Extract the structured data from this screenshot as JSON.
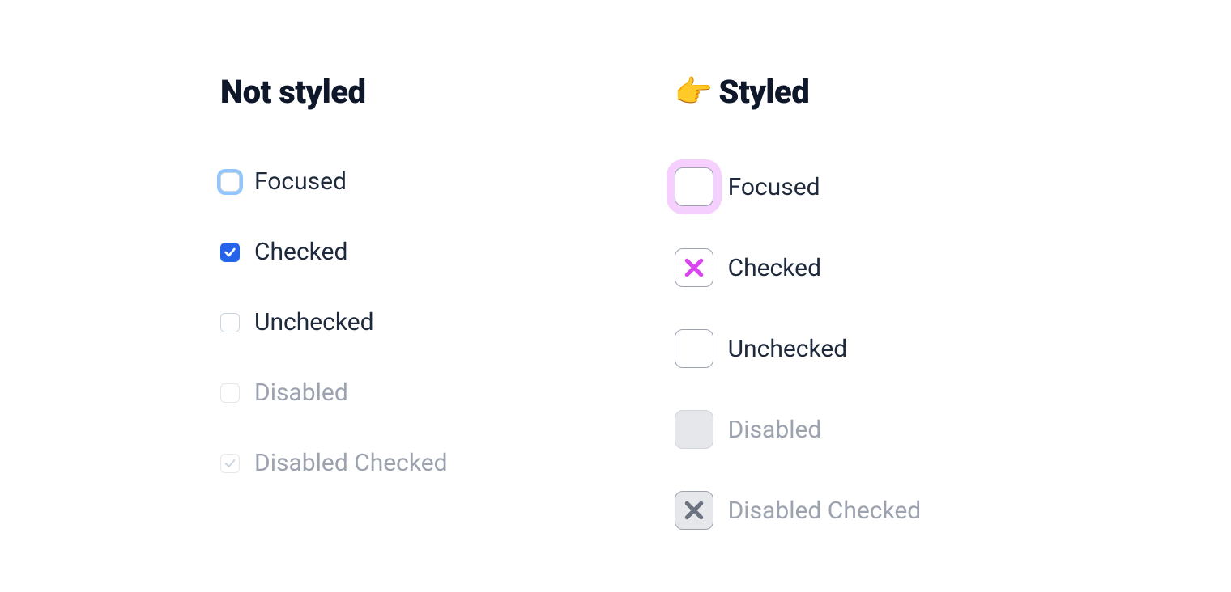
{
  "columns": {
    "not_styled": {
      "heading": "Not styled",
      "states": {
        "focused": "Focused",
        "checked": "Checked",
        "unchecked": "Unchecked",
        "disabled": "Disabled",
        "disabled_checked": "Disabled Checked"
      }
    },
    "styled": {
      "heading": "Styled",
      "emoji": "👉",
      "states": {
        "focused": "Focused",
        "checked": "Checked",
        "unchecked": "Unchecked",
        "disabled": "Disabled",
        "disabled_checked": "Disabled Checked"
      }
    }
  },
  "colors": {
    "native_focus_ring": "#93c5fd",
    "native_checked_bg": "#2563eb",
    "styled_focus_ring": "#f5d0fe",
    "styled_check_mark": "#d946ef",
    "disabled_text": "#9ca3af",
    "text": "#1e293b"
  }
}
